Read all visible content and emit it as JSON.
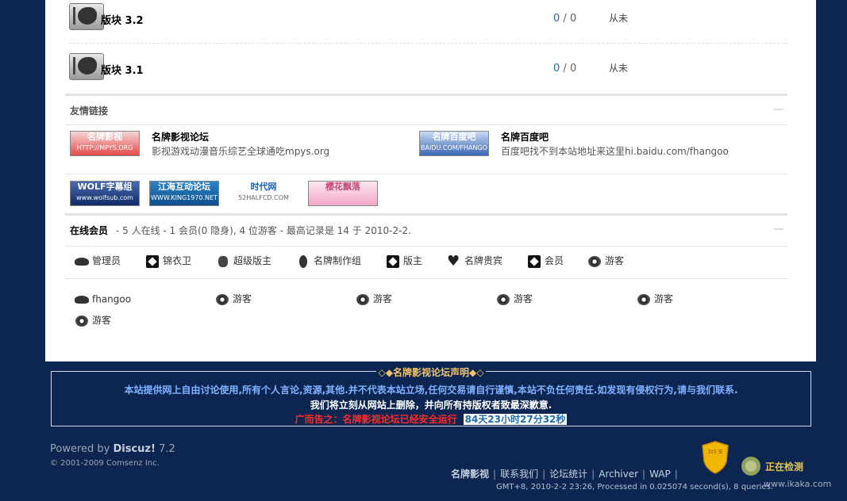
{
  "forums": [
    {
      "name": "版块  3.2",
      "posts": "0",
      "sep": " / ",
      "total": "0",
      "last": "从未"
    },
    {
      "name": "版块  3.1",
      "posts": "0",
      "sep": " / ",
      "total": "0",
      "last": "从未"
    }
  ],
  "links": {
    "section_title": "友情链接",
    "collapse_label": "—",
    "items": [
      {
        "logo_text": "名牌影视",
        "logo_sub": "HTTP://MPYS.ORG",
        "title": "名牌影视论坛",
        "desc": "影视游戏动漫音乐综艺全球通吃mpys.org"
      },
      {
        "logo_text": "名牌百度吧",
        "logo_sub": "BAIDU.COM/FHANGO",
        "title": "名牌百度吧",
        "desc": "百度吧找不到本站地址来这里hi.baidu.com/fhangoo"
      }
    ],
    "banners": [
      {
        "text": "WOLF字幕组",
        "sub": "www.wolfsub.com"
      },
      {
        "text": "江海互动论坛",
        "sub": "WWW.KING1970.NET"
      },
      {
        "text": "时代网",
        "sub": "52HALFCD.COM"
      },
      {
        "text": "樱花飘落",
        "sub": ""
      }
    ]
  },
  "online": {
    "title": "在线会员",
    "summary": "- 5 人在线  - 1 会员(0 隐身), 4 位游客  - 最高记录是  14 于  2010-2-2.",
    "collapse_label": "—",
    "legend": [
      {
        "label": "管理员",
        "icon": "bat-icon"
      },
      {
        "label": "锦衣卫",
        "icon": "box-icon"
      },
      {
        "label": "超级版主",
        "icon": "bug-icon"
      },
      {
        "label": "名牌制作组",
        "icon": "beetle-icon"
      },
      {
        "label": "版主",
        "icon": "box-icon"
      },
      {
        "label": "名牌贵宾",
        "icon": "heart-icon"
      },
      {
        "label": "会员",
        "icon": "box-icon"
      },
      {
        "label": "游客",
        "icon": "eye-icon"
      }
    ],
    "users": [
      {
        "label": "fhangoo",
        "icon": "bat-icon"
      },
      {
        "label": "游客",
        "icon": "eye-icon"
      },
      {
        "label": "游客",
        "icon": "eye-icon"
      },
      {
        "label": "游客",
        "icon": "eye-icon"
      },
      {
        "label": "游客",
        "icon": "eye-icon"
      },
      {
        "label": "游客",
        "icon": "eye-icon"
      }
    ]
  },
  "statement": {
    "title": "◇◆名牌影视论坛声明◆◇",
    "line1": "本站提供网上自由讨论使用,所有个人言论,资源,其他.并不代表本站立场,任何交易请自行谨慎,本站不负任何责任.如发现有侵权行为,请与我们联系.",
    "line2": "我们将立刻从网站上删除，并向所有持版权者致最深歉意.",
    "notice": "广而告之：名牌影视论坛已经安全运行",
    "uptime": "84天23小时27分32秒"
  },
  "footer": {
    "powered_prefix": "Powered by ",
    "powered_brand": "Discuz!",
    "version": " 7.2",
    "copyright": "© 2001-2009 Comsenz Inc.",
    "nav": [
      "名牌影视",
      "联系我们",
      "论坛统计",
      "Archiver",
      "WAP"
    ],
    "gmt": "GMT+8, 2010-2-2 23:26, Processed in 0.025074 second(s), 8 queries.",
    "shield_text": "315 安",
    "badge_text": "正在检测",
    "watermark": "www.ikaka.com"
  },
  "colors": {
    "page_bg": "#0d2651",
    "statement_title": "#f1c36b",
    "statement_line1": "#7fb1ff",
    "notice_red": "#ff2b2b",
    "link_blue": "#1c6bb5"
  }
}
